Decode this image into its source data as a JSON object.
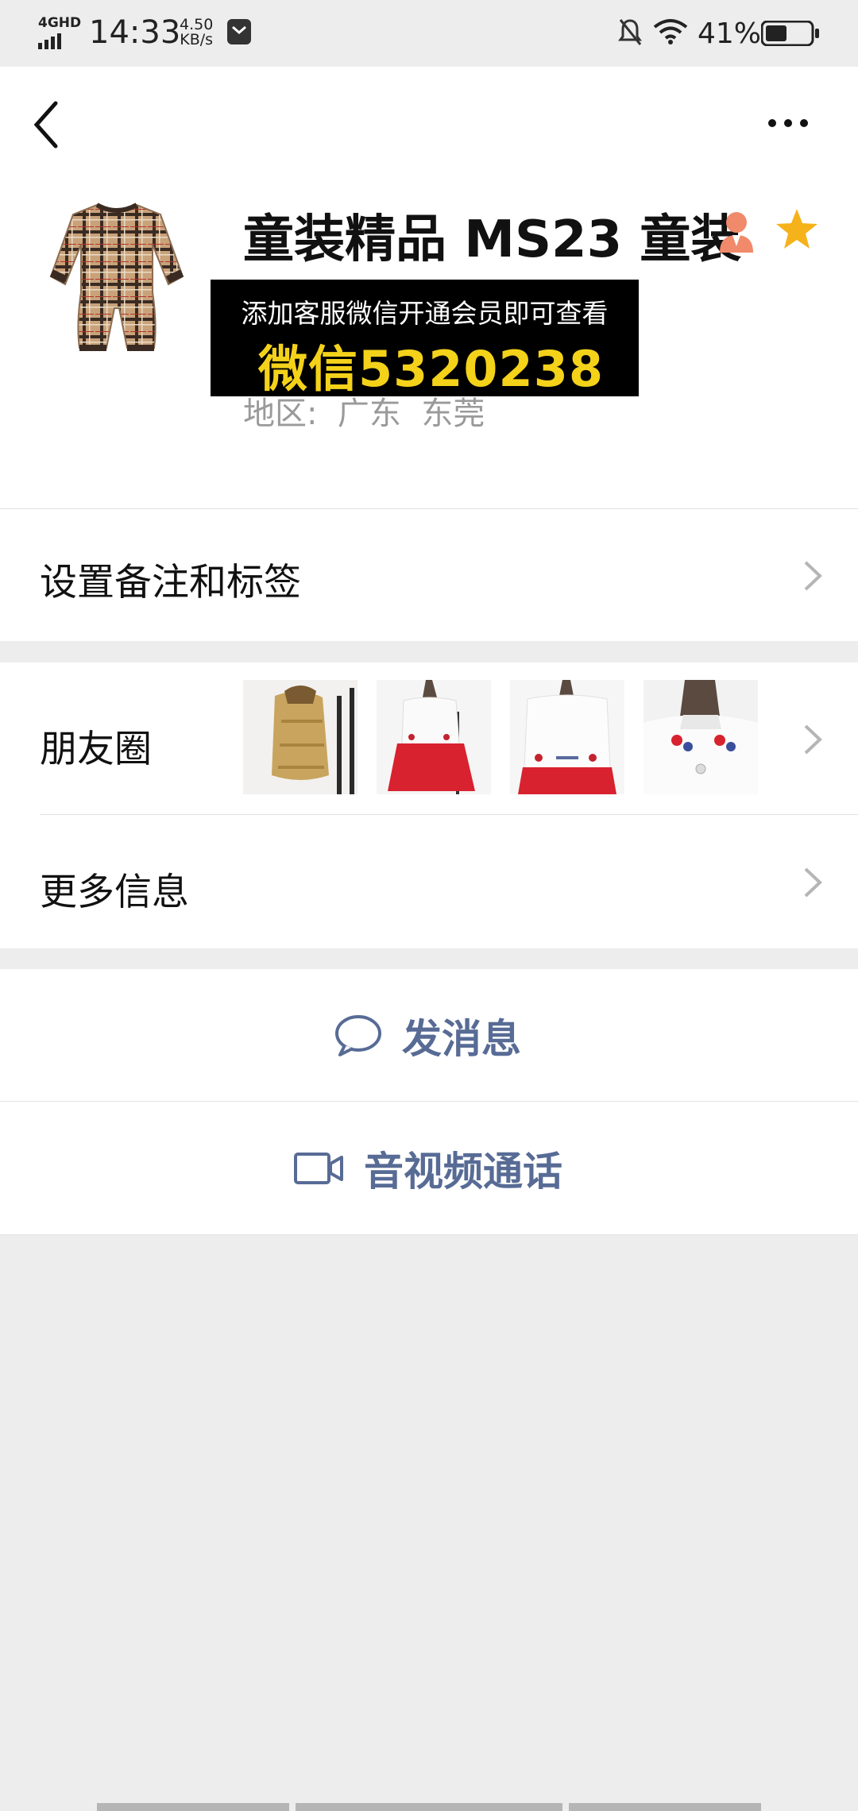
{
  "status_bar": {
    "network": "4G",
    "network_sub": "HD",
    "time": "14:33",
    "speed_value": "4.50",
    "speed_unit": "KB/s",
    "battery": "41%"
  },
  "header": {
    "back_icon": "back-arrow-icon",
    "more_icon": "more-dots-icon"
  },
  "profile": {
    "name": "童装精品 MS23 童装",
    "promo_line1": "添加客服微信开通会员即可查看",
    "promo_line2": "微信5320238",
    "region": "地区:  广东  东莞",
    "badge_color": "#f08a6a",
    "star_color": "#f6b21b"
  },
  "rows": {
    "remark_label": "设置备注和标签",
    "moments_label": "朋友圈",
    "more_info_label": "更多信息"
  },
  "actions": {
    "message_label": "发消息",
    "call_label": "音视频通话",
    "accent_color": "#576b95"
  }
}
